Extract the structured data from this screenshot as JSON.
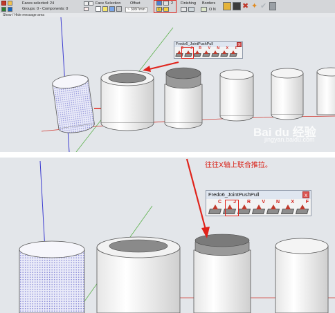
{
  "toolbar": {
    "faces_selected": "Faces selected: 24",
    "groups_components": "Groups: 0 - Components: 0",
    "face_selection_label": "Face Selection",
    "offset_label": "Offset",
    "offset_value": "~ 3097mm",
    "finishing_label": "Finishing",
    "borders_label": "Borders",
    "count_value": "2",
    "on_labels": "O N",
    "cp_labels": "C   P"
  },
  "message_area": "Show / Hide message area",
  "palette": {
    "title": "Fredo6_JointPushPull",
    "close": "x",
    "tool_letters": [
      "C",
      "J",
      "R",
      "V",
      "N",
      "X",
      "F"
    ]
  },
  "annotation": "往往X轴上联合推拉。",
  "watermark": {
    "logo": "Bai du 经验",
    "url": "jingyan.baidu.com"
  },
  "colors": {
    "highlight": "#e0231b",
    "viewport_bg": "#e3e6ea",
    "red_axis": "#d0342c",
    "green_axis": "#5ab04a",
    "blue_axis": "#3a3ad0"
  }
}
